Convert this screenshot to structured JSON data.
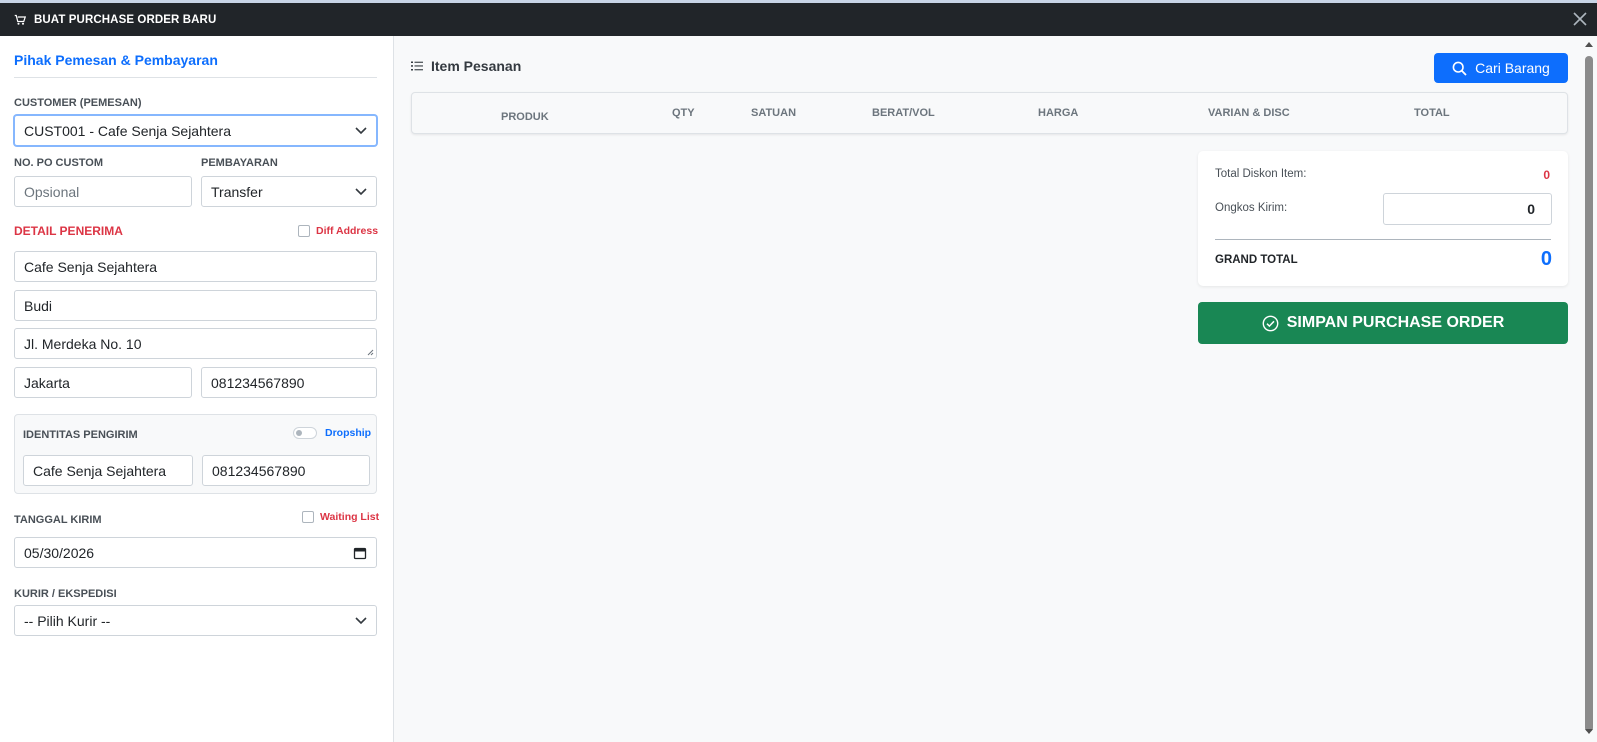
{
  "window": {
    "title": "BUAT PURCHASE ORDER BARU"
  },
  "left": {
    "section_title": "Pihak Pemesan & Pembayaran",
    "customer": {
      "label": "CUSTOMER (PEMESAN)",
      "value": "CUST001 - Cafe Senja Sejahtera"
    },
    "po_custom": {
      "label": "NO. PO CUSTOM",
      "placeholder": "Opsional"
    },
    "payment": {
      "label": "PEMBAYARAN",
      "value": "Transfer"
    },
    "recipient": {
      "label": "DETAIL PENERIMA",
      "diff_address_label": "Diff Address",
      "name": "Cafe Senja Sejahtera",
      "contact": "Budi",
      "address": "Jl. Merdeka No. 10",
      "city": "Jakarta",
      "phone": "081234567890"
    },
    "sender": {
      "label": "IDENTITAS PENGIRIM",
      "dropship_label": "Dropship",
      "name": "Cafe Senja Sejahtera",
      "phone": "081234567890"
    },
    "ship_date": {
      "label": "TANGGAL KIRIM",
      "value": "05/30/2026",
      "waiting_list_label": "Waiting List"
    },
    "courier": {
      "label": "KURIR / EKSPEDISI",
      "value": "-- Pilih Kurir --"
    }
  },
  "right": {
    "items_title": "Item Pesanan",
    "search_button": "Cari Barang",
    "table_headers": [
      "PRODUK",
      "QTY",
      "SATUAN",
      "BERAT/VOL",
      "HARGA",
      "VARIAN & DISC",
      "TOTAL"
    ],
    "summary": {
      "discount_label": "Total Diskon Item:",
      "discount_value": "0",
      "shipping_label": "Ongkos Kirim:",
      "shipping_value": "0",
      "grand_total_label": "GRAND TOTAL",
      "grand_total_value": "0"
    },
    "save_button": "SIMPAN PURCHASE ORDER"
  },
  "colors": {
    "primary": "#0d6efd",
    "danger": "#dc3545",
    "success": "#198754",
    "dark": "#212529"
  }
}
